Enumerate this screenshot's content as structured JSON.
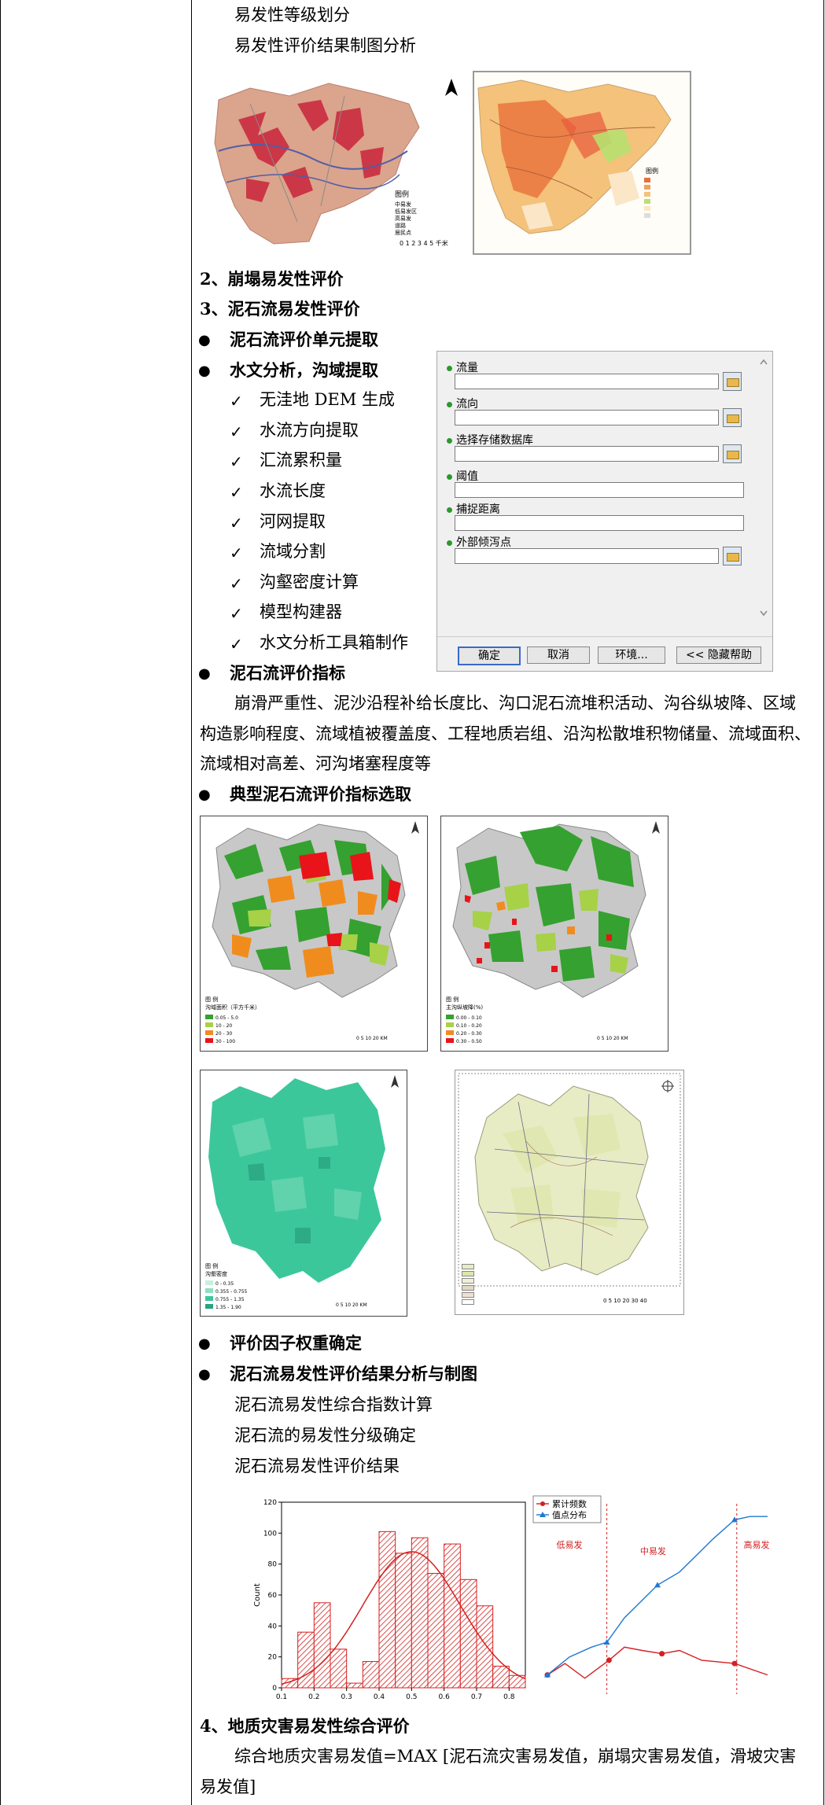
{
  "text": {
    "l1": "易发性等级划分",
    "l2": "易发性评价结果制图分析",
    "h_collapse": "2、崩塌易发性评价",
    "h_debris": "3、泥石流易发性评价",
    "b_unit": "泥石流评价单元提取",
    "b_hydro": "水文分析，沟域提取",
    "c1": "无洼地 DEM 生成",
    "c2": "水流方向提取",
    "c3": "汇流累积量",
    "c4": "水流长度",
    "c5": "河网提取",
    "c6": "流域分割",
    "c7": "沟壑密度计算",
    "c8": "模型构建器",
    "c9": "水文分析工具箱制作",
    "b_index": "泥石流评价指标",
    "para1_a": "崩滑严重性、泥沙沿程补给长度比、沟口泥石流堆积活动、沟谷纵坡降、区域",
    "para1_b": "构造影响程度、流域植被覆盖度、工程地质岩组、沿沟松散堆积物储量、流域面积、",
    "para1_c": "流域相对高差、河沟堵塞程度等",
    "b_select": "典型泥石流评价指标选取",
    "b_weight": "评价因子权重确定",
    "b_result": "泥石流易发性评价结果分析与制图",
    "r1": "泥石流易发性综合指数计算",
    "r2": "泥石流的易发性分级确定",
    "r3": "泥石流易发性评价结果",
    "h_comp": "4、地质灾害易发性综合评价",
    "para2_a": "综合地质灾害易发值=MAX [泥石流灾害易发值，崩塌灾害易发值，滑坡灾害",
    "para2_b": "易发值]"
  },
  "check_mark": "✓",
  "bullet_mark": "●",
  "map1": {
    "legend_title": "图例",
    "legend_items": [
      "中易发",
      "低易发区",
      "高易发",
      "道路",
      "居民点"
    ],
    "scale": "0 1 2 3 4 5 千米"
  },
  "map2": {
    "legend_title": "图例"
  },
  "dialog": {
    "fields": [
      {
        "label": "流量",
        "has_browse": true
      },
      {
        "label": "流向",
        "has_browse": true
      },
      {
        "label": "选择存储数据库",
        "has_browse": true
      },
      {
        "label": "阈值",
        "has_browse": false
      },
      {
        "label": "捕捉距离",
        "has_browse": false
      },
      {
        "label": "外部倾泻点",
        "has_browse": true
      }
    ],
    "ok": "确定",
    "cancel": "取消",
    "env": "环境...",
    "help": "<< 隐藏帮助"
  },
  "index_maps": {
    "a_legend": "图 例",
    "a_title": "沟域面积（平方千米）",
    "a_items": [
      "0.05 - 5.0",
      "10 - 20",
      "20 - 30",
      "30 - 100"
    ],
    "a_scale": "0  5  10      20 KM",
    "b_legend": "图 例",
    "b_title": "主沟纵坡降(%)",
    "b_items": [
      "0.00 - 0.10",
      "0.10 - 0.20",
      "0.20 - 0.30",
      "0.30 - 0.50"
    ],
    "b_scale": "0  5  10      20 KM",
    "c_legend": "图 例",
    "c_title": "沟壑密度",
    "c_items": [
      "0 - 0.35",
      "0.355 - 0.755",
      "0.755 - 1.35",
      "1.35 - 1.90"
    ],
    "c_scale": "0  5  10      20 KM",
    "d_scale": "0  5 10    20     30     40"
  },
  "colors": {
    "green_map": "#3cc79b",
    "debris_green": "#35a130",
    "debris_orange": "#f08c1e",
    "debris_red": "#e8141a",
    "debris_lightgreen": "#a7d147",
    "grey": "#c8c8c8",
    "hist_red": "#d42020",
    "line_blue": "#1e78d2"
  },
  "chart_data": [
    {
      "type": "bar",
      "title": "",
      "xlabel": "",
      "ylabel": "Count",
      "xlim": [
        0.1,
        0.85
      ],
      "ylim": [
        0,
        120
      ],
      "xticks": [
        "0.1",
        "0.2",
        "0.3",
        "0.4",
        "0.5",
        "0.6",
        "0.7",
        "0.8"
      ],
      "yticks": [
        "0",
        "20",
        "40",
        "60",
        "80",
        "100",
        "120"
      ],
      "bin_width": 0.05,
      "bin_left": [
        0.1,
        0.15,
        0.2,
        0.25,
        0.3,
        0.35,
        0.4,
        0.45,
        0.5,
        0.55,
        0.6,
        0.65,
        0.7,
        0.75,
        0.8
      ],
      "values": [
        6,
        36,
        55,
        25,
        3,
        17,
        101,
        87,
        97,
        74,
        93,
        70,
        53,
        14,
        8
      ],
      "fit_curve": {
        "mean": 0.5,
        "peak": 88,
        "sigma": 0.15
      }
    },
    {
      "type": "line",
      "legend": [
        "累计频数",
        "值点分布"
      ],
      "annotations": [
        "低易发",
        "中易发",
        "高易发"
      ],
      "series": [
        {
          "name": "累计频数",
          "color": "#d42020",
          "marker": "circle",
          "x": [
            0,
            0.08,
            0.17,
            0.28,
            0.35,
            0.43,
            0.52,
            0.6,
            0.7,
            0.85,
            1.0
          ],
          "y": [
            0.05,
            0.12,
            0.03,
            0.14,
            0.22,
            0.2,
            0.18,
            0.2,
            0.14,
            0.12,
            0.05
          ]
        },
        {
          "name": "值点分布",
          "color": "#1e78d2",
          "marker": "triangle",
          "x": [
            0,
            0.1,
            0.2,
            0.27,
            0.35,
            0.5,
            0.6,
            0.75,
            0.85,
            0.92,
            1.0
          ],
          "y": [
            0.05,
            0.16,
            0.22,
            0.25,
            0.4,
            0.6,
            0.68,
            0.88,
            1.0,
            1.02,
            1.02
          ]
        }
      ],
      "dividers": [
        0.27,
        0.86
      ]
    }
  ]
}
